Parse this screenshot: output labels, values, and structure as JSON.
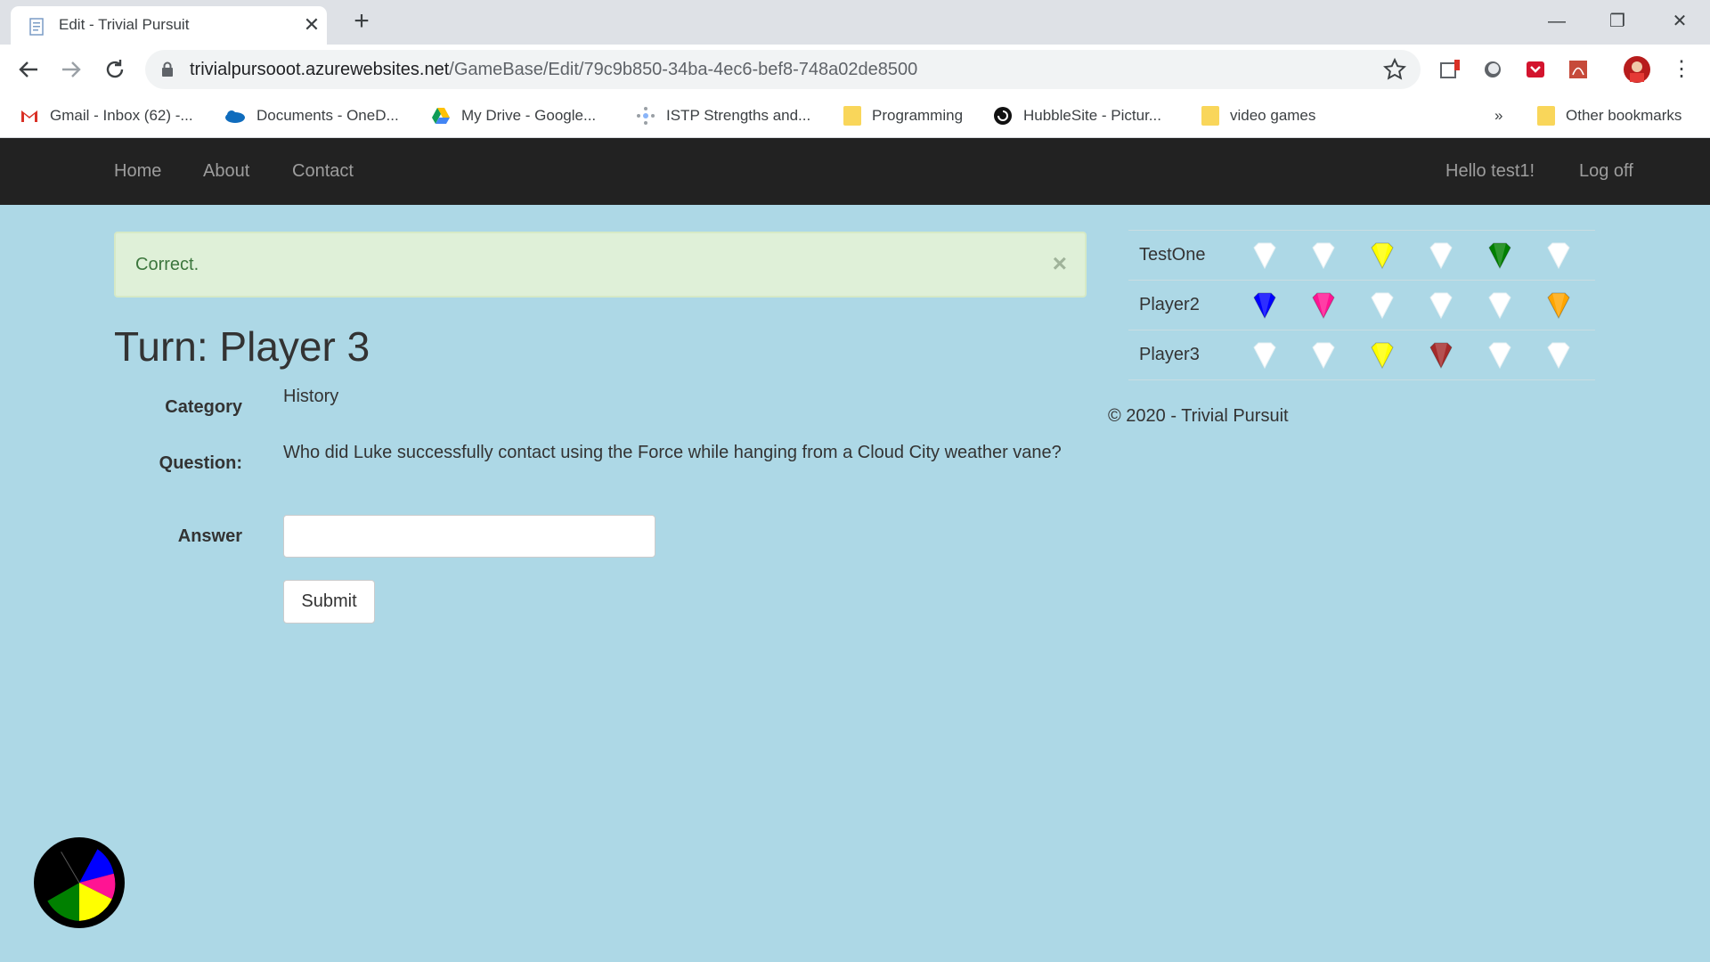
{
  "browser": {
    "tab_title": "Edit - Trivial Pursuit",
    "url_host": "trivialpursooot.azurewebsites.net",
    "url_path": "/GameBase/Edit/79c9b850-34ba-4ec6-bef8-748a02de8500"
  },
  "bookmarks": {
    "items": [
      {
        "label": "Gmail - Inbox (62) -...",
        "icon": "gmail-icon"
      },
      {
        "label": "Documents - OneD...",
        "icon": "onedrive-icon"
      },
      {
        "label": "My Drive - Google...",
        "icon": "google-drive-icon"
      },
      {
        "label": "ISTP Strengths and...",
        "icon": "istp-icon"
      },
      {
        "label": "Programming",
        "icon": "folder-icon"
      },
      {
        "label": "HubbleSite - Pictur...",
        "icon": "hubble-icon"
      },
      {
        "label": "video games",
        "icon": "folder-icon"
      }
    ],
    "overflow": "»",
    "other": "Other bookmarks"
  },
  "nav": {
    "home": "Home",
    "about": "About",
    "contact": "Contact",
    "greeting": "Hello test1!",
    "logoff": "Log off"
  },
  "alert": {
    "text": "Correct.",
    "close": "×"
  },
  "turn": "Turn: Player 3",
  "form": {
    "category_label": "Category",
    "category_value": "History",
    "question_label": "Question:",
    "question_value": "Who did Luke successfully contact using the Force while hanging from a Cloud City weather vane?",
    "answer_label": "Answer",
    "answer_value": "",
    "submit": "Submit"
  },
  "colors": {
    "white": "#ffffff",
    "blue": "#0000ff",
    "pink": "#ff1493",
    "yellow": "#ffff00",
    "brown": "#a52a2a",
    "green": "#008000",
    "orange": "#ffa500"
  },
  "scoreboard": [
    {
      "name": "TestOne",
      "wedges": [
        "white",
        "white",
        "yellow",
        "white",
        "green",
        "white"
      ]
    },
    {
      "name": "Player2",
      "wedges": [
        "blue",
        "pink",
        "white",
        "white",
        "white",
        "orange"
      ]
    },
    {
      "name": "Player3",
      "wedges": [
        "white",
        "white",
        "yellow",
        "brown",
        "white",
        "white"
      ]
    }
  ],
  "footer": "© 2020 - Trivial Pursuit"
}
